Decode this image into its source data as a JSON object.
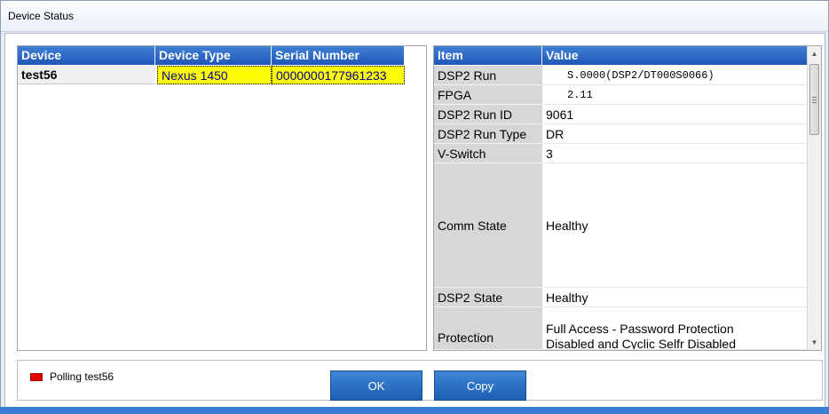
{
  "window": {
    "title": "Device Status"
  },
  "device_grid": {
    "headers": [
      "Device",
      "Device Type",
      "Serial Number"
    ],
    "rows": [
      {
        "device": "test56",
        "device_type": "Nexus 1450",
        "serial_number": "0000000177961233"
      }
    ]
  },
  "property_grid": {
    "headers": {
      "item": "Item",
      "value": "Value"
    },
    "rows": [
      {
        "item": "DSP2 Run",
        "value": "S.0000(DSP2/DT000S0066)"
      },
      {
        "item": "FPGA",
        "value": "2.11"
      },
      {
        "item": "DSP2 Run ID",
        "value": "9061"
      },
      {
        "item": "DSP2 Run Type",
        "value": "DR"
      },
      {
        "item": "V-Switch",
        "value": "3"
      },
      {
        "item": "Comm State",
        "value": "Healthy"
      },
      {
        "item": "DSP2 State",
        "value": "Healthy"
      },
      {
        "item": "Protection",
        "value": "Full Access - Password Protection\nDisabled and Cyclic Selfr Disabled"
      }
    ]
  },
  "status": {
    "text": "Polling test56",
    "indicator_color": "#e40000"
  },
  "buttons": {
    "ok": "OK",
    "copy": "Copy"
  },
  "colors": {
    "header_blue": "#1f58b8",
    "highlight_yellow": "#ffff00"
  }
}
